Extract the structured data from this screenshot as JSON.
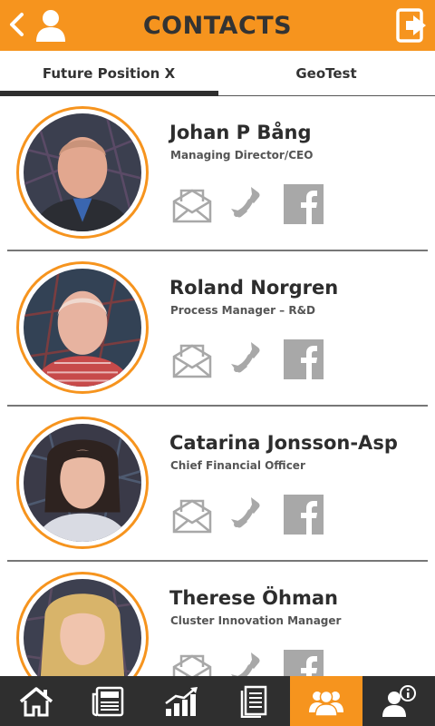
{
  "header": {
    "title": "CONTACTS"
  },
  "tabs": [
    {
      "label": "Future Position X",
      "active": true
    },
    {
      "label": "GeoTest",
      "active": false
    }
  ],
  "contacts": [
    {
      "name": "Johan P Bång",
      "role": "Managing Director/CEO"
    },
    {
      "name": "Roland Norgren",
      "role": "Process Manager – R&D"
    },
    {
      "name": "Catarina Jonsson-Asp",
      "role": "Chief Financial Officer"
    },
    {
      "name": "Therese Öhman",
      "role": "Cluster Innovation Manager"
    }
  ],
  "bottom_nav": [
    {
      "icon": "home-icon",
      "active": false
    },
    {
      "icon": "news-icon",
      "active": false
    },
    {
      "icon": "chart-icon",
      "active": false
    },
    {
      "icon": "document-icon",
      "active": false
    },
    {
      "icon": "contacts-icon",
      "active": true
    },
    {
      "icon": "info-person-icon",
      "active": false
    }
  ],
  "colors": {
    "accent": "#f6941e",
    "dark": "#2f2f2f",
    "icon_gray": "#a8a8a8"
  }
}
